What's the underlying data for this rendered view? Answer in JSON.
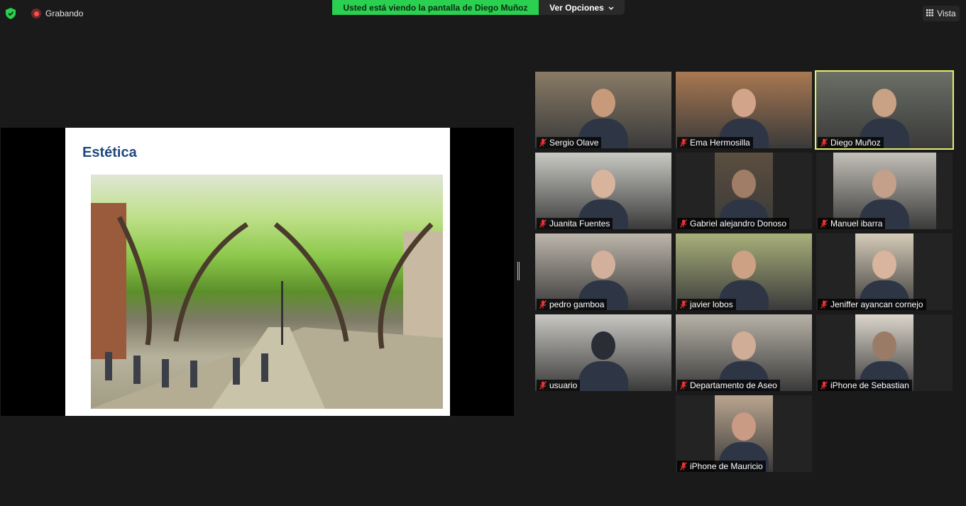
{
  "top": {
    "recording_label": "Grabando",
    "banner_text": "Usted está viendo la pantalla de Diego Muñoz",
    "options_label": "Ver Opciones",
    "view_label": "Vista"
  },
  "share": {
    "slide_title": "Estética"
  },
  "participants": [
    {
      "name": "Sergio Olave",
      "feed_color": "#8a7b66",
      "face": "#c79a7c",
      "active": false
    },
    {
      "name": "Ema Hermosilla",
      "feed_color": "#a97851",
      "face": "#d2a58a",
      "active": false
    },
    {
      "name": "Diego Muñoz",
      "feed_color": "#6b6f66",
      "face": "#c9a184",
      "active": true
    },
    {
      "name": "Juanita Fuentes",
      "feed_color": "#c9c9c4",
      "face": "#d8b49d",
      "active": false
    },
    {
      "name": "Gabriel alejandro Donoso",
      "feed_color": "#5b4e3e",
      "face": "#a07d66",
      "active": false
    },
    {
      "name": "Manuel ibarra",
      "feed_color": "#c3c0b8",
      "face": "#c4a08a",
      "active": false
    },
    {
      "name": "pedro gamboa",
      "feed_color": "#bdb6ab",
      "face": "#d3b09b",
      "active": false
    },
    {
      "name": "javier lobos",
      "feed_color": "#a9b07a",
      "face": "#cda184",
      "active": false
    },
    {
      "name": "Jeniffer ayancan cornejo",
      "feed_color": "#d6cbb8",
      "face": "#d9b59d",
      "active": false
    },
    {
      "name": "usuario",
      "feed_color": "#c8c7c2",
      "face": "#2a2c36",
      "active": false
    },
    {
      "name": "Departamento de Aseo",
      "feed_color": "#b7b2a7",
      "face": "#d0ad96",
      "active": false
    },
    {
      "name": "iPhone de Sebastian",
      "feed_color": "#dcd6cc",
      "face": "#9a7b66",
      "active": false
    },
    {
      "name": "iPhone de Mauricio",
      "feed_color": "#b9a58e",
      "face": "#c99a84",
      "active": false
    }
  ]
}
